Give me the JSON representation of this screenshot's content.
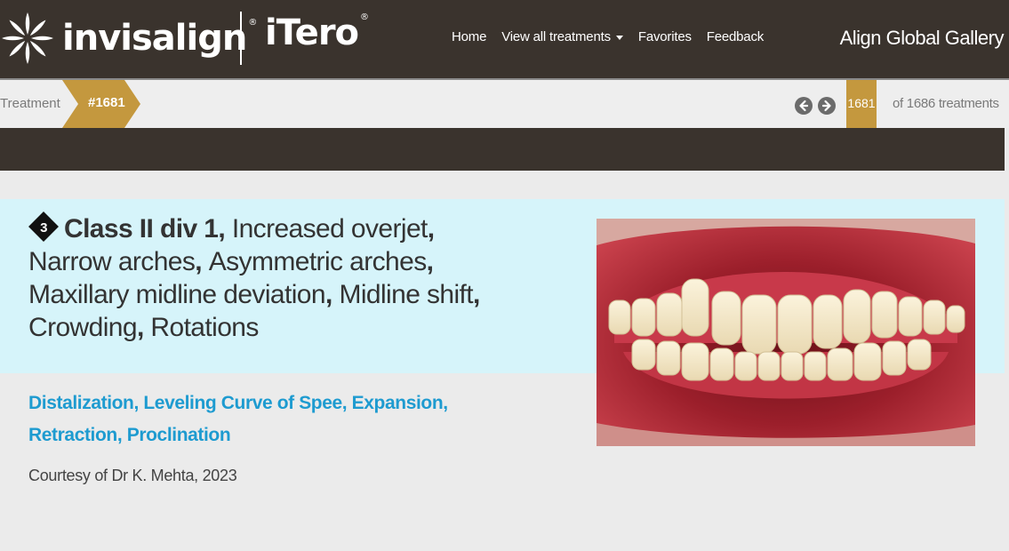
{
  "header": {
    "brand_invisalign": "invisalign",
    "brand_itero": "iTero",
    "registered_mark": "®",
    "nav": {
      "home": "Home",
      "view_all": "View all treatments",
      "favorites": "Favorites",
      "feedback": "Feedback"
    },
    "gallery_title": "Align Global Gallery"
  },
  "breadcrumb": {
    "treatment_label": "Treatment",
    "treatment_number": "#1681"
  },
  "pager": {
    "current": "1681",
    "total_text": "of 1686 treatments"
  },
  "case": {
    "badge_number": "3",
    "primary_condition": "Class II div 1",
    "conditions": [
      "Increased overjet",
      "Narrow arches",
      "Asymmetric arches",
      "Maxillary midline deviation",
      "Midline shift",
      "Crowding",
      "Rotations"
    ],
    "procedures": [
      "Distalization",
      "Leveling Curve of Spee",
      "Expansion",
      "Retraction",
      "Proclination"
    ],
    "courtesy": "Courtesy of Dr K. Mehta, 2023"
  },
  "colors": {
    "header_bg": "#3a332d",
    "accent_gold": "#c4983e",
    "panel_bg": "#d6f4fa",
    "procedure_blue": "#1e9bd0"
  }
}
